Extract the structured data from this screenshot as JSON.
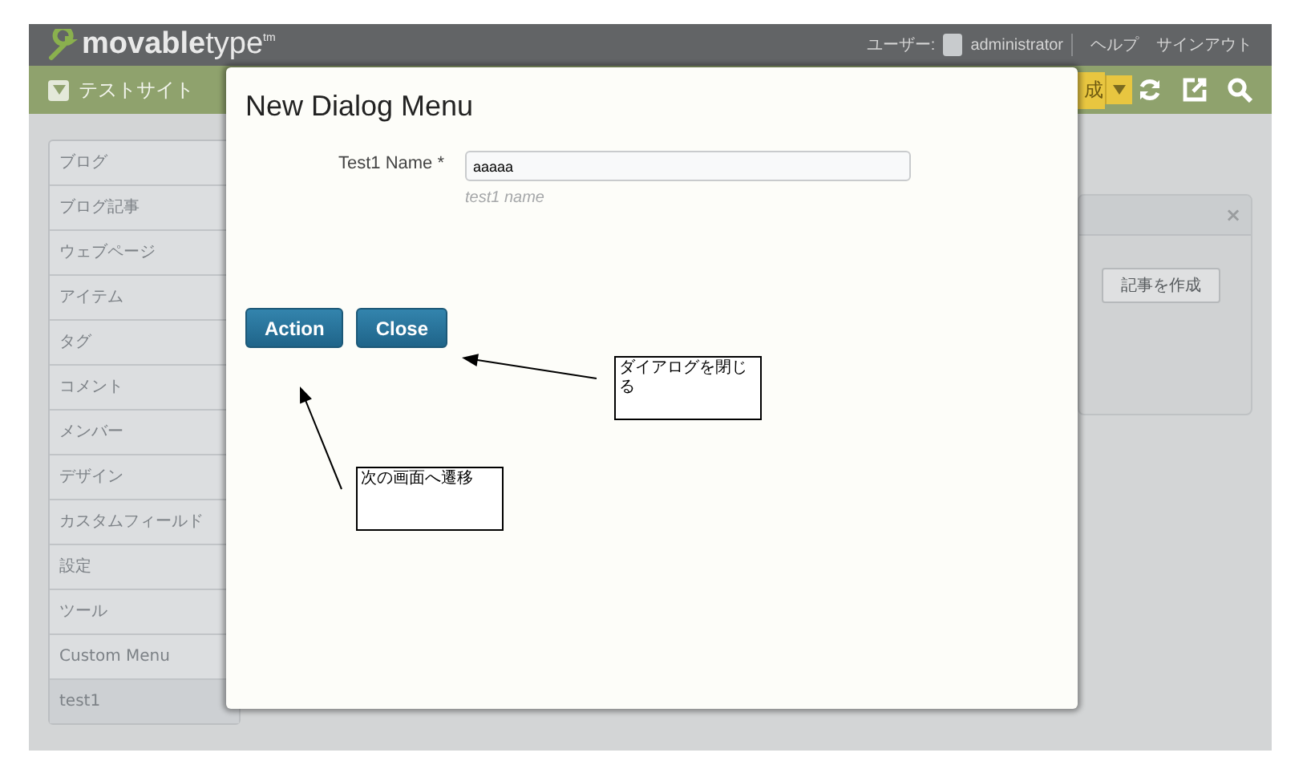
{
  "header": {
    "logo": "**movable**type$^{tm}$",
    "user_label": "ユーザー:",
    "user": "administrator",
    "links": [
      "ヘルプ",
      "サインアウト"
    ]
  },
  "site_bar": {
    "site_name": "テストサイト",
    "create_button_fragment": "成"
  },
  "sidebar": {
    "items": [
      {
        "label": "ブログ",
        "selected": false
      },
      {
        "label": "ブログ記事",
        "selected": false
      },
      {
        "label": "ウェブページ",
        "selected": false
      },
      {
        "label": "アイテム",
        "selected": false
      },
      {
        "label": "タグ",
        "selected": false
      },
      {
        "label": "コメント",
        "selected": false
      },
      {
        "label": "メンバー",
        "selected": false
      },
      {
        "label": "デザイン",
        "selected": false
      },
      {
        "label": "カスタムフィールド",
        "selected": false
      },
      {
        "label": "設定",
        "selected": false
      },
      {
        "label": "ツール",
        "selected": false
      },
      {
        "label": "Custom Menu",
        "selected": false
      },
      {
        "label": "test1",
        "selected": true
      }
    ]
  },
  "widget": {
    "close": "×",
    "button": "記事を作成"
  },
  "dialog": {
    "title": "New Dialog Menu",
    "field_label": "Test1 Name *",
    "field_value": "aaaaa",
    "field_hint": "test1 name",
    "buttons": [
      "Action",
      "Close"
    ]
  },
  "annotations": [
    {
      "text": "ダイアログを閉じる"
    },
    {
      "text": "次の画面へ遷移"
    }
  ]
}
